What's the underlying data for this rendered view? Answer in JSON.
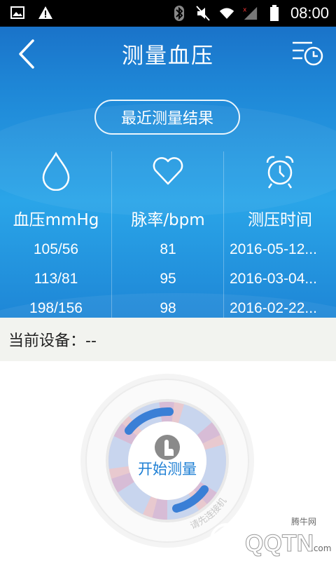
{
  "status_bar": {
    "time": "08:00",
    "icons": [
      "image-icon",
      "warning-icon",
      "bluetooth-icon",
      "mute-icon",
      "wifi-icon",
      "signal-icon",
      "battery-icon"
    ]
  },
  "header": {
    "title": "测量血压",
    "back_icon": "chevron-left-icon",
    "history_icon": "history-icon"
  },
  "recent_button": {
    "label": "最近测量结果"
  },
  "columns": [
    {
      "icon": "drop-icon",
      "header": "血压mmHg",
      "values": [
        "105/56",
        "113/81",
        "198/156"
      ]
    },
    {
      "icon": "heart-icon",
      "header": "脉率/bpm",
      "values": [
        "81",
        "95",
        "98"
      ]
    },
    {
      "icon": "alarm-clock-icon",
      "header": "测压时间",
      "values": [
        "2016-05-12...",
        "2016-03-04...",
        "2016-02-22..."
      ]
    }
  ],
  "device": {
    "label": "当前设备：--"
  },
  "dial": {
    "button_label": "开始测量",
    "hint": "请先连接机器蓝牙然后开始测量",
    "icon": "touch-icon"
  },
  "watermark": {
    "small_text": "腾牛网",
    "brand": "QQTN.com"
  },
  "colors": {
    "header_blue": "#1e86d6",
    "accent_blue": "#1e7fd4",
    "device_bg": "#f2f3ef"
  }
}
